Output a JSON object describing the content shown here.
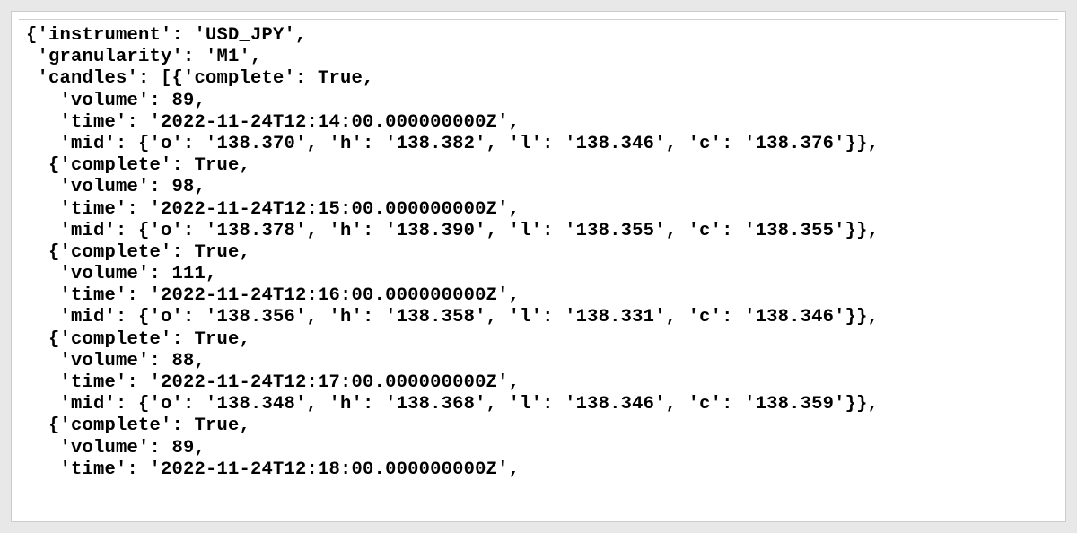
{
  "code": {
    "lines": [
      "{'instrument': 'USD_JPY',",
      " 'granularity': 'M1',",
      " 'candles': [{'complete': True,",
      "   'volume': 89,",
      "   'time': '2022-11-24T12:14:00.000000000Z',",
      "   'mid': {'o': '138.370', 'h': '138.382', 'l': '138.346', 'c': '138.376'}},",
      "  {'complete': True,",
      "   'volume': 98,",
      "   'time': '2022-11-24T12:15:00.000000000Z',",
      "   'mid': {'o': '138.378', 'h': '138.390', 'l': '138.355', 'c': '138.355'}},",
      "  {'complete': True,",
      "   'volume': 111,",
      "   'time': '2022-11-24T12:16:00.000000000Z',",
      "   'mid': {'o': '138.356', 'h': '138.358', 'l': '138.331', 'c': '138.346'}},",
      "  {'complete': True,",
      "   'volume': 88,",
      "   'time': '2022-11-24T12:17:00.000000000Z',",
      "   'mid': {'o': '138.348', 'h': '138.368', 'l': '138.346', 'c': '138.359'}},",
      "  {'complete': True,",
      "   'volume': 89,",
      "   'time': '2022-11-24T12:18:00.000000000Z',"
    ]
  }
}
